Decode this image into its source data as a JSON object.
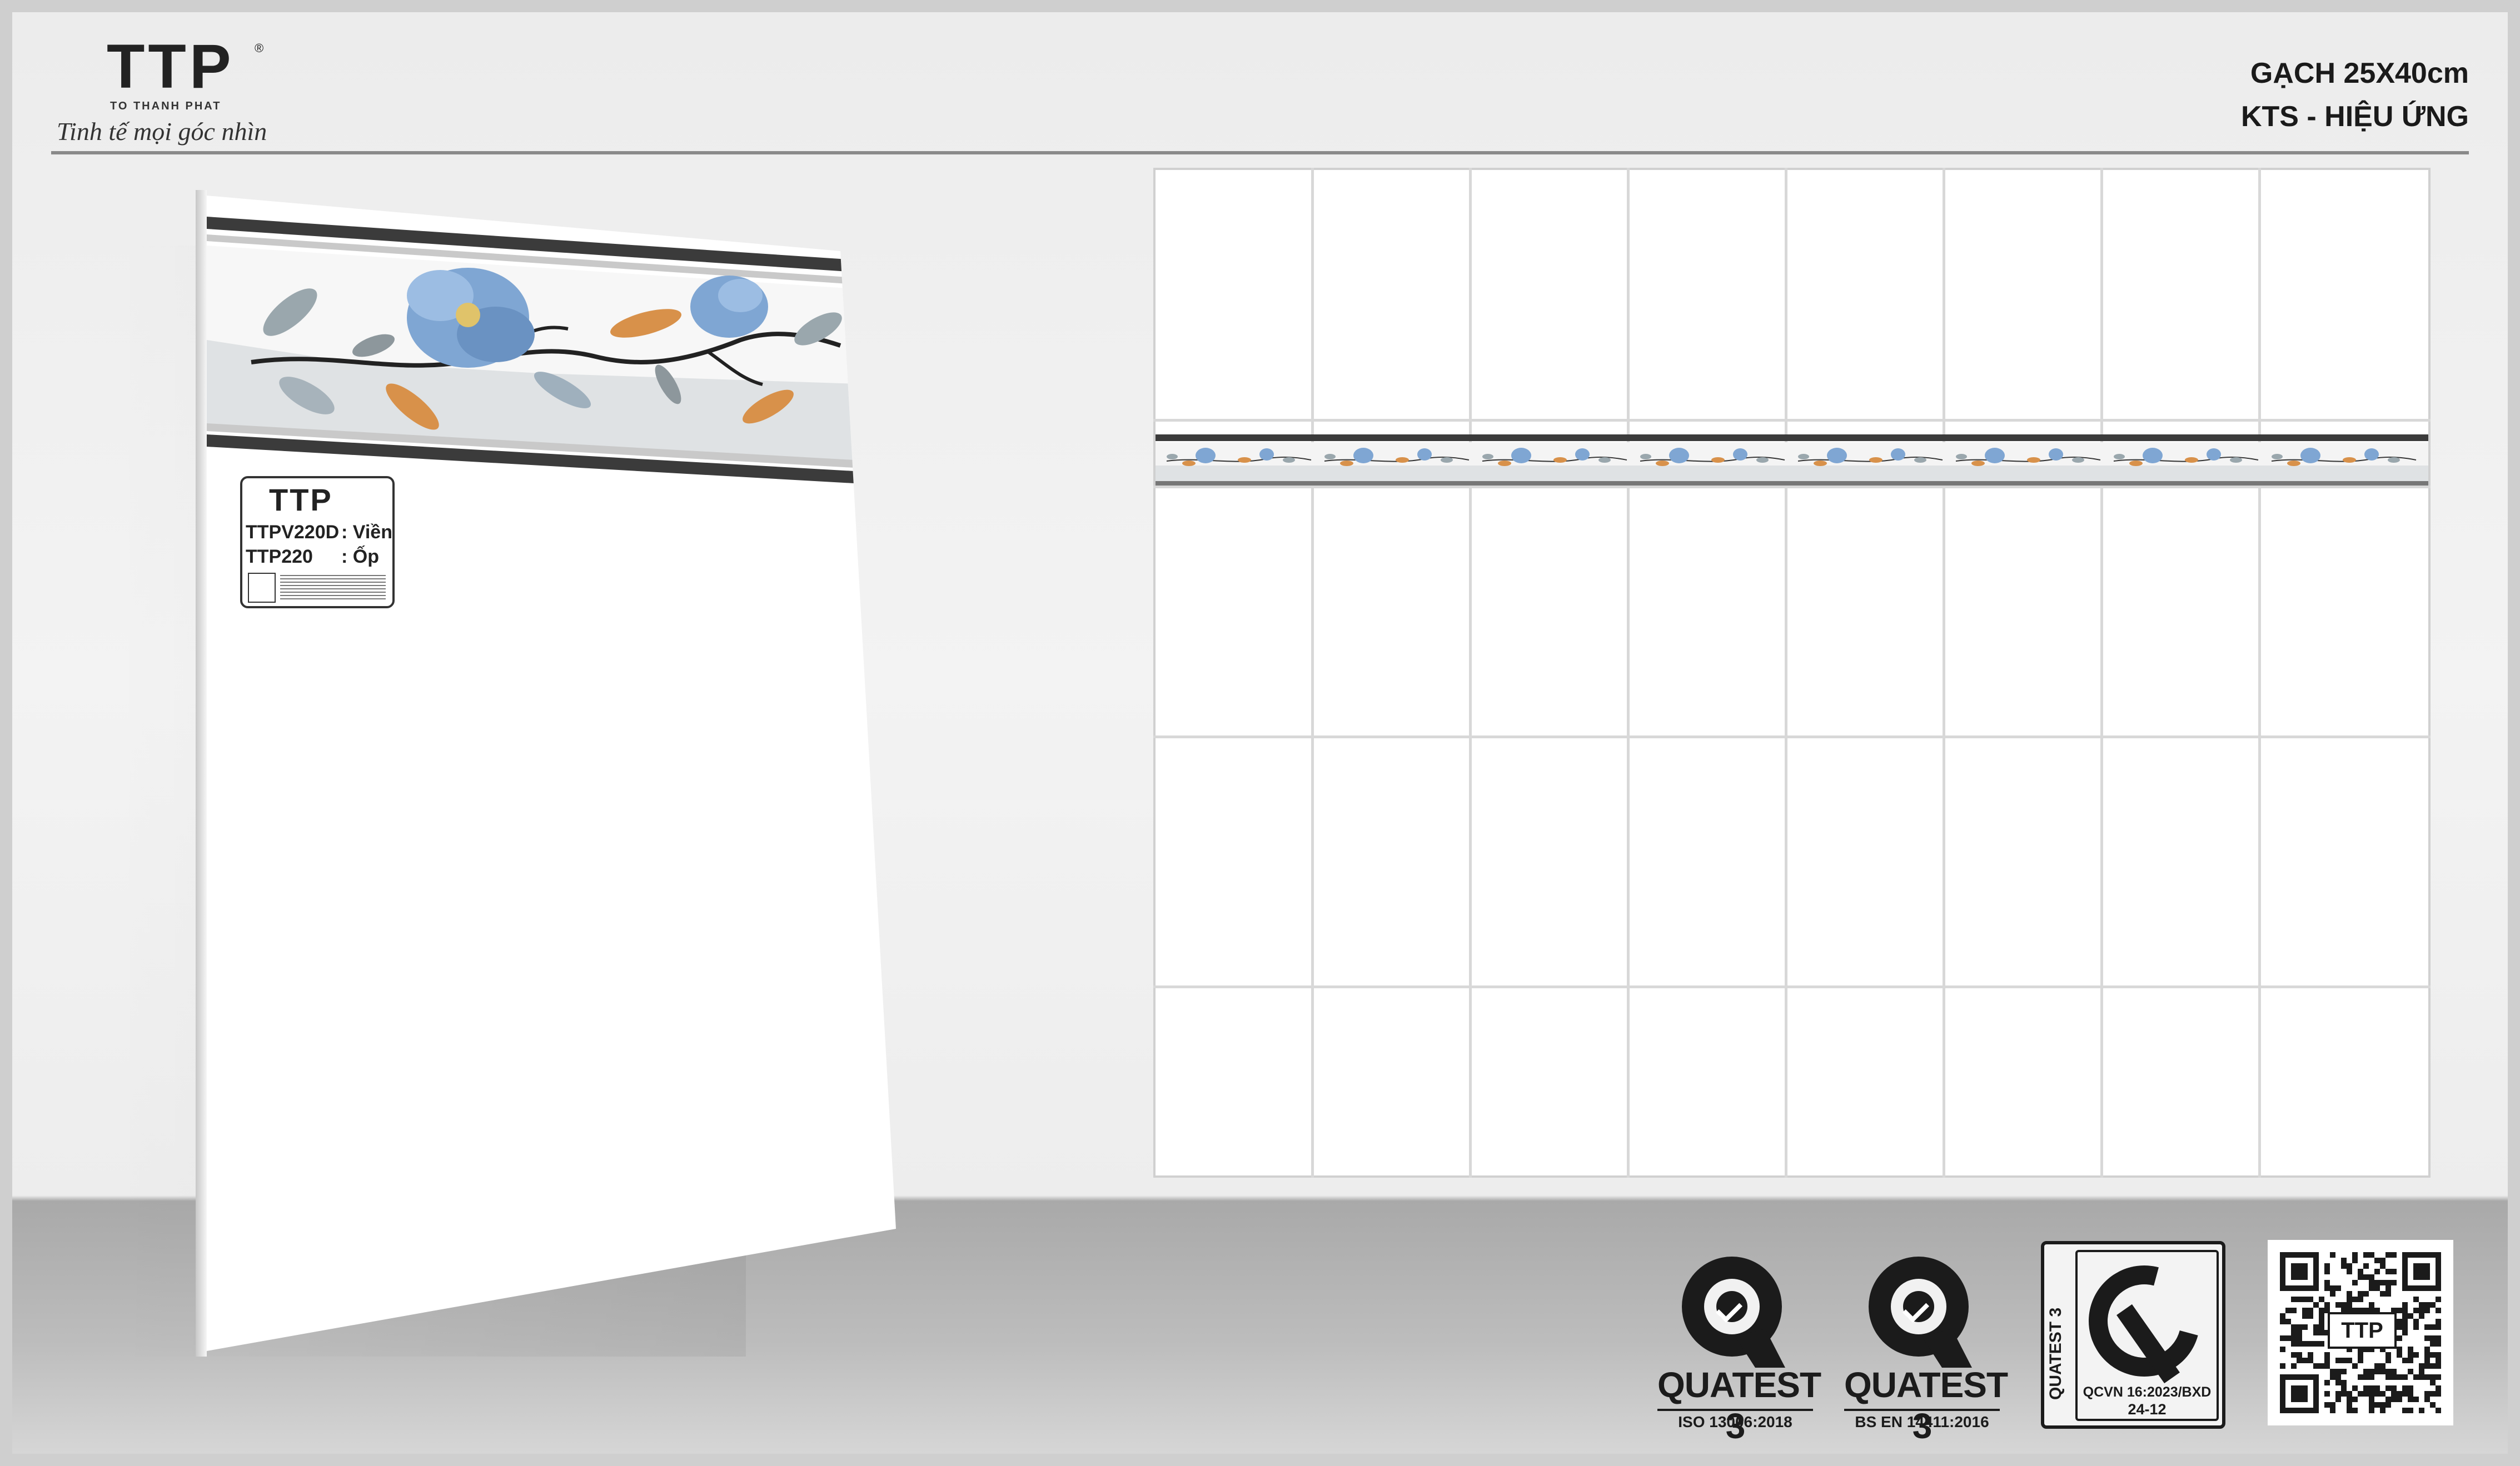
{
  "header": {
    "brand_mark": "TTP",
    "brand_registered": "®",
    "brand_sub": "TO THANH PHAT",
    "brand_slogan": "Tinh tế mọi góc nhìn",
    "product_size": "GẠCH 25X40cm",
    "product_effect": "KTS - HIỆU ỨNG"
  },
  "tile_label": {
    "brand_mark": "TTP",
    "brand_registered": "®",
    "rows": [
      {
        "code": "TTPV220D",
        "value": ": Viền"
      },
      {
        "code": "TTP220",
        "value": ": Ốp"
      }
    ]
  },
  "certifications": [
    {
      "name": "QUATEST 3",
      "standard": "ISO 13006:2018"
    },
    {
      "name": "QUATEST 3",
      "standard": "BS EN 14411:2016"
    }
  ],
  "cr_mark": {
    "side_text": "QUATEST 3",
    "code": "QCVN 16:2023/BXD",
    "number": "24-12"
  },
  "qr": {
    "label": "TTP"
  },
  "colors": {
    "flower_blue": "#7fa6d3",
    "leaf_orange": "#d8914a",
    "leaf_grey": "#9aa7ad",
    "border_dark": "#3b3b3b",
    "wall_tile": "#ffffff",
    "grout": "#d8d8d8"
  }
}
